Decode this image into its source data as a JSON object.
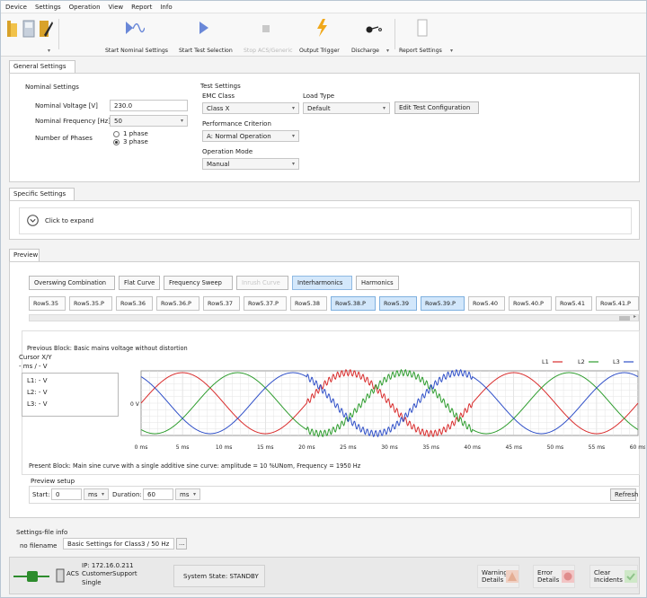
{
  "menu": [
    "Device",
    "Settings",
    "Operation",
    "View",
    "Report",
    "Info"
  ],
  "toolbar": {
    "start_nominal": "Start Nominal Settings",
    "start_test": "Start Test Selection",
    "stop": "Stop ACS/Generic",
    "output_trigger": "Output Trigger",
    "discharge": "Discharge",
    "report_settings": "Report Settings"
  },
  "general": {
    "tab": "General Settings",
    "nominal_title": "Nominal Settings",
    "voltage_label": "Nominal Voltage [V]",
    "voltage_value": "230.0",
    "freq_label": "Nominal Frequency [Hz]",
    "freq_value": "50",
    "phases_label": "Number of Phases",
    "phase1": "1 phase",
    "phase3": "3 phase",
    "test_title": "Test Settings",
    "emc_label": "EMC Class",
    "emc_value": "Class X",
    "load_label": "Load Type",
    "load_value": "Default",
    "edit_button": "Edit Test Configuration",
    "perf_label": "Performance Criterion",
    "perf_value": "A: Normal Operation",
    "mode_label": "Operation Mode",
    "mode_value": "Manual"
  },
  "specific": {
    "tab": "Specific Settings",
    "expand": "Click to expand"
  },
  "preview": {
    "tab": "Preview",
    "tabs": [
      "Overswing Combination",
      "Flat Curve",
      "Frequency Sweep",
      "Inrush Curve",
      "Interharmonics",
      "Harmonics"
    ],
    "rows": [
      "Row5.35",
      "Row5.35.P",
      "Row5.36",
      "Row5.36.P",
      "Row5.37",
      "Row5.37.P",
      "Row5.38",
      "Row5.38.P",
      "Row5.39",
      "Row5.39.P",
      "Row5.40",
      "Row5.40.P",
      "Row5.41",
      "Row5.41.P"
    ],
    "previous": "Previous Block: Basic mains voltage without distortion",
    "cursor": "Cursor X/Y",
    "cursor_units": "- ms / - V",
    "l1": "L1: - V",
    "l2": "L2: - V",
    "l3": "L3: - V",
    "zero_v": "0 V",
    "legend": [
      "L1",
      "L2",
      "L3"
    ],
    "present": "Present Block: Main sine curve with a single additive sine curve: amplitude = 10 %UNom, Frequency = 1950 Hz",
    "setup_title": "Preview setup",
    "start_label": "Start:",
    "start_value": "0",
    "start_unit": "ms",
    "duration_label": "Duration:",
    "duration_value": "60",
    "duration_unit": "ms",
    "refresh": "Refresh"
  },
  "chart_data": {
    "type": "line",
    "x": [
      0,
      5,
      10,
      15,
      20,
      25,
      30,
      35,
      40,
      45,
      50,
      55,
      60
    ],
    "x_ticks": [
      "0 ms",
      "5 ms",
      "10 ms",
      "15 ms",
      "20 ms",
      "25 ms",
      "30 ms",
      "35 ms",
      "40 ms",
      "45 ms",
      "50 ms",
      "55 ms",
      "60 ms"
    ],
    "series": [
      {
        "name": "L1",
        "color": "#d92d2d"
      },
      {
        "name": "L2",
        "color": "#2f9d2f"
      },
      {
        "name": "L3",
        "color": "#3050c8"
      }
    ]
  },
  "settings_file": {
    "title": "Settings-file info",
    "filename": "no filename",
    "description": "Basic Settings for Class3 / 50 Hz",
    "browse": "..."
  },
  "status": {
    "ip": "IP: 172.16.0.211",
    "acs": "ACS",
    "customer": "CustomerSupport",
    "single": "Single",
    "state": "System State: STANDBY",
    "warning": "Warning Details",
    "error": "Error Details",
    "clear": "Clear Incidents"
  },
  "colors": {
    "accent": "#d4e8fb",
    "red": "#d92d2d",
    "green": "#2f9d2f",
    "blue": "#3050c8"
  }
}
